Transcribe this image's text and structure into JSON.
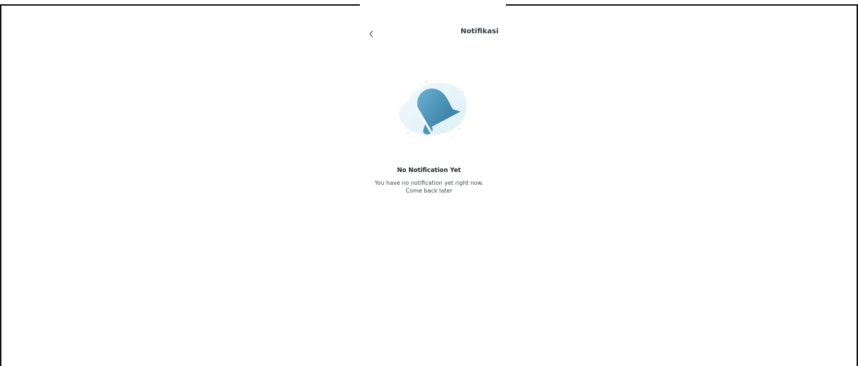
{
  "header": {
    "title": "Notifikasi",
    "back_icon": "chevron-left-icon"
  },
  "empty_state": {
    "illustration_icon": "bell-off-icon",
    "title": "No Notification Yet",
    "description_line1": "You have no notification yet right now.",
    "description_line2": "Come back later"
  },
  "colors": {
    "accent": "#4a9cc0",
    "blob": "#e6f4fa",
    "title_text": "#333a40"
  }
}
